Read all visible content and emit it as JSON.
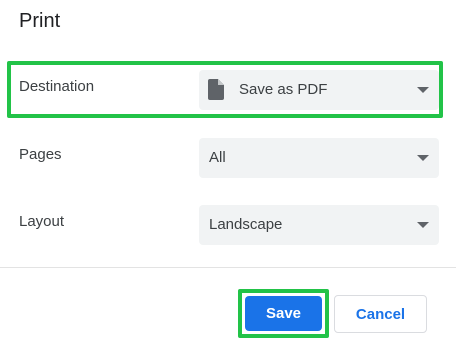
{
  "dialog": {
    "title": "Print"
  },
  "settings": {
    "destination": {
      "label": "Destination",
      "value": "Save as PDF",
      "icon": "document-icon"
    },
    "pages": {
      "label": "Pages",
      "value": "All"
    },
    "layout": {
      "label": "Layout",
      "value": "Landscape"
    }
  },
  "buttons": {
    "save_label": "Save",
    "cancel_label": "Cancel"
  },
  "colors": {
    "highlight": "#22c348",
    "primary": "#1a73e8",
    "select_bg": "#f1f3f4"
  }
}
